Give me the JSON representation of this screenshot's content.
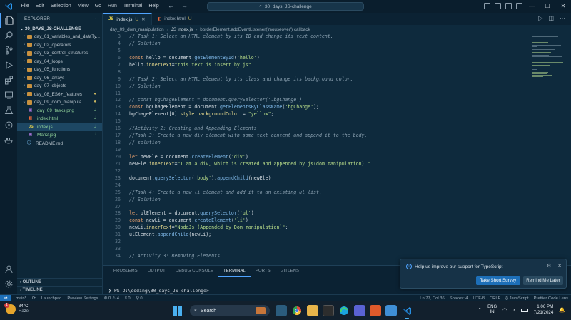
{
  "titlebar": {
    "menu": [
      "File",
      "Edit",
      "Selection",
      "View",
      "Go",
      "Run",
      "Terminal",
      "Help"
    ],
    "search_text": "30_days_JS-challenge"
  },
  "sidebar": {
    "title": "EXPLORER",
    "root_folder": "30_DAYS_JS-CHALLENGE",
    "items": [
      {
        "name": "day_01_variables_and_dataTy...",
        "type": "folder",
        "open": false,
        "badge": ""
      },
      {
        "name": "day_02_operators",
        "type": "folder",
        "open": false,
        "badge": ""
      },
      {
        "name": "day_03_control_structures",
        "type": "folder",
        "open": false,
        "badge": ""
      },
      {
        "name": "day_04_loops",
        "type": "folder",
        "open": false,
        "badge": ""
      },
      {
        "name": "day_05_functions",
        "type": "folder",
        "open": false,
        "badge": ""
      },
      {
        "name": "day_06_arrays",
        "type": "folder",
        "open": false,
        "badge": ""
      },
      {
        "name": "day_07_objects",
        "type": "folder",
        "open": false,
        "badge": ""
      },
      {
        "name": "day_08_ES6+_features",
        "type": "folder",
        "open": false,
        "badge": "●"
      },
      {
        "name": "day_09_dom_manipula...",
        "type": "folder",
        "open": true,
        "badge": "●"
      },
      {
        "name": "day_09_tasks.png",
        "type": "png",
        "child": true,
        "badge": "U"
      },
      {
        "name": "index.html",
        "type": "html",
        "child": true,
        "badge": "U"
      },
      {
        "name": "index.js",
        "type": "js",
        "child": true,
        "badge": "U",
        "selected": true
      },
      {
        "name": "Man2.jpg",
        "type": "jpg",
        "child": true,
        "badge": "U"
      },
      {
        "name": "README.md",
        "type": "md",
        "child": false,
        "badge": ""
      }
    ],
    "outline_label": "OUTLINE",
    "timeline_label": "TIMELINE"
  },
  "tabs": [
    {
      "label": "index.js",
      "icon": "JS",
      "status": "U",
      "active": true
    },
    {
      "label": "index.html",
      "icon": "html",
      "status": "U",
      "active": false
    }
  ],
  "breadcrumb": [
    "day_09_dom_manipulation",
    "JS index.js",
    "borderElement.addEventListener('mouseover') callback"
  ],
  "code_lines": [
    {
      "n": "3",
      "parts": [
        [
          "c",
          "// Task 1: Select an HTML element by its ID and change its text content."
        ]
      ]
    },
    {
      "n": "4",
      "parts": [
        [
          "c",
          "// Solution"
        ]
      ]
    },
    {
      "n": "5",
      "parts": []
    },
    {
      "n": "6",
      "parts": [
        [
          "k",
          "const "
        ],
        [
          "p",
          "hello = document."
        ],
        [
          "f",
          "getElementById"
        ],
        [
          "p",
          "("
        ],
        [
          "s",
          "'hello'"
        ],
        [
          "p",
          ")"
        ]
      ]
    },
    {
      "n": "7",
      "parts": [
        [
          "p",
          "hello."
        ],
        [
          "y",
          "innerText"
        ],
        [
          "p",
          "="
        ],
        [
          "s",
          "\"this text is insert by js\""
        ]
      ]
    },
    {
      "n": "8",
      "parts": []
    },
    {
      "n": "9",
      "parts": [
        [
          "c",
          "// Task 2: Select an HTML element by its class and change its background color."
        ]
      ]
    },
    {
      "n": "10",
      "parts": [
        [
          "c",
          "// Solution"
        ]
      ]
    },
    {
      "n": "11",
      "parts": []
    },
    {
      "n": "12",
      "parts": [
        [
          "c",
          "// const bgChageElement = document.querySelector('.bgChange')"
        ]
      ]
    },
    {
      "n": "13",
      "parts": [
        [
          "k",
          "const "
        ],
        [
          "p",
          "bgChageElement = document."
        ],
        [
          "f",
          "getElementsByClassName"
        ],
        [
          "p",
          "("
        ],
        [
          "s",
          "'bgChange'"
        ],
        [
          "p",
          ");"
        ]
      ]
    },
    {
      "n": "14",
      "parts": [
        [
          "p",
          "bgChageElement[0]."
        ],
        [
          "y",
          "style"
        ],
        [
          "p",
          "."
        ],
        [
          "y",
          "backgroundColor"
        ],
        [
          "p",
          " = "
        ],
        [
          "s",
          "\"yellow\""
        ],
        [
          "p",
          ";"
        ]
      ]
    },
    {
      "n": "15",
      "parts": []
    },
    {
      "n": "16",
      "parts": [
        [
          "c",
          "//Activity 2: Creating and Appending Elements"
        ]
      ]
    },
    {
      "n": "17",
      "parts": [
        [
          "c",
          "//Task 3: Create a new div element with some text content and append it to the body."
        ]
      ]
    },
    {
      "n": "18",
      "parts": [
        [
          "c",
          "// solution"
        ]
      ]
    },
    {
      "n": "19",
      "parts": []
    },
    {
      "n": "20",
      "parts": [
        [
          "k",
          "let "
        ],
        [
          "p",
          "newEle = document."
        ],
        [
          "f",
          "createElement"
        ],
        [
          "p",
          "("
        ],
        [
          "s",
          "'div'"
        ],
        [
          "p",
          ")"
        ]
      ]
    },
    {
      "n": "21",
      "parts": [
        [
          "p",
          "newEle."
        ],
        [
          "y",
          "innerText"
        ],
        [
          "p",
          "="
        ],
        [
          "s",
          "\"I am a div, which is created and appended by js(dom manipulation).\""
        ]
      ]
    },
    {
      "n": "22",
      "parts": []
    },
    {
      "n": "23",
      "parts": [
        [
          "p",
          "document."
        ],
        [
          "f",
          "querySelector"
        ],
        [
          "p",
          "("
        ],
        [
          "s",
          "'body'"
        ],
        [
          "p",
          ")."
        ],
        [
          "f",
          "appendChild"
        ],
        [
          "p",
          "(newEle)"
        ]
      ]
    },
    {
      "n": "24",
      "parts": []
    },
    {
      "n": "25",
      "parts": [
        [
          "c",
          "//Task 4: Create a new li element and add it to an existing ul list."
        ]
      ]
    },
    {
      "n": "26",
      "parts": [
        [
          "c",
          "// Solution"
        ]
      ]
    },
    {
      "n": "27",
      "parts": []
    },
    {
      "n": "28",
      "parts": [
        [
          "k",
          "let "
        ],
        [
          "p",
          "ulElement = document."
        ],
        [
          "f",
          "querySelector"
        ],
        [
          "p",
          "("
        ],
        [
          "s",
          "'ul'"
        ],
        [
          "p",
          ")"
        ]
      ]
    },
    {
      "n": "29",
      "parts": [
        [
          "k",
          "const "
        ],
        [
          "p",
          "newLi = document."
        ],
        [
          "f",
          "createElement"
        ],
        [
          "p",
          "("
        ],
        [
          "s",
          "'li'"
        ],
        [
          "p",
          ")"
        ]
      ]
    },
    {
      "n": "30",
      "parts": [
        [
          "p",
          "newLi."
        ],
        [
          "y",
          "innerText"
        ],
        [
          "p",
          "="
        ],
        [
          "s",
          "\"NodeJs (Appended by Dom manipulation)\""
        ],
        [
          "p",
          ";"
        ]
      ]
    },
    {
      "n": "31",
      "parts": [
        [
          "p",
          "ulElement."
        ],
        [
          "f",
          "appendChild"
        ],
        [
          "p",
          "(newLi);"
        ]
      ]
    },
    {
      "n": "32",
      "parts": []
    },
    {
      "n": "33",
      "parts": []
    },
    {
      "n": "34",
      "parts": [
        [
          "c",
          "// Activity 3: Removing Elements"
        ]
      ]
    }
  ],
  "panel": {
    "tabs": [
      "PROBLEMS",
      "OUTPUT",
      "DEBUG CONSOLE",
      "TERMINAL",
      "PORTS",
      "GITLENS"
    ],
    "active_tab": "TERMINAL",
    "prompt": "PS D:\\coding\\30_days_JS-challenge>"
  },
  "notification": {
    "message": "Help us improve our support for TypeScript",
    "primary_label": "Take Short Survey",
    "secondary_label": "Remind Me Later"
  },
  "statusbar": {
    "left": [
      "main*",
      "⟳",
      "Launchpad",
      "Preview Settings",
      "⊗ 0 ⚠ 4",
      "ʬ 0",
      "⚲ 0"
    ],
    "right": [
      "Ln 77, Col 36",
      "Spaces: 4",
      "UTF-8",
      "CRLF",
      "{} JavaScript",
      "Prettier Code Lens"
    ]
  },
  "taskbar": {
    "temperature": "34°C",
    "condition": "Haze",
    "weather_badge": "1",
    "search_label": "Search",
    "lang_line1": "ENG",
    "lang_line2": "IN",
    "time": "1:06 PM",
    "date": "7/21/2024"
  },
  "colors": {
    "accent": "#4fa3ff",
    "primary_button": "#1d6fb8",
    "modified": "#c8b560"
  }
}
